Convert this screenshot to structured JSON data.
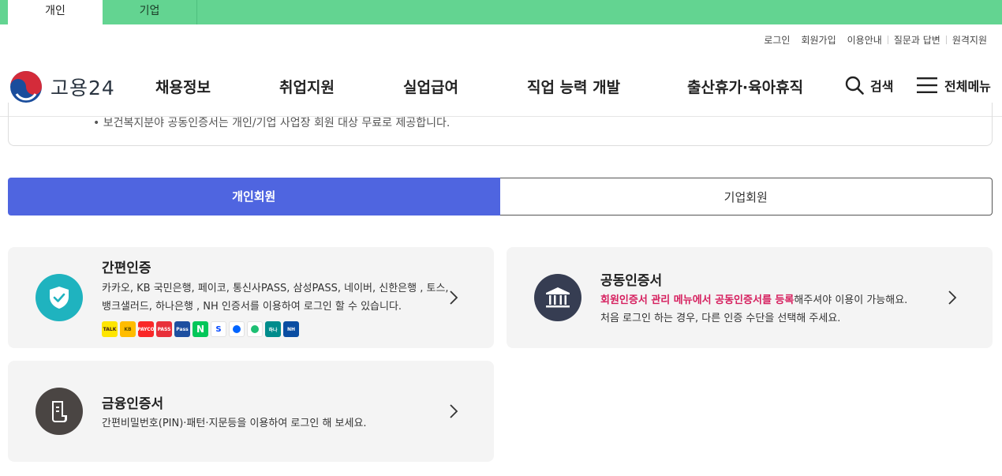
{
  "top_tabs": [
    {
      "label": "개인",
      "active": true
    },
    {
      "label": "기업",
      "active": false
    }
  ],
  "utility_links": [
    "로그인",
    "회원가입",
    "이용안내",
    "질문과 답변",
    "원격지원"
  ],
  "logo": {
    "text": "고용24"
  },
  "nav": [
    "채용정보",
    "취업지원",
    "실업급여",
    "직업 능력 개발",
    "출산휴가·육아휴직"
  ],
  "search": {
    "label": "검색"
  },
  "menu": {
    "label": "전체메뉴"
  },
  "notice": {
    "text": "• 보건복지분야 공동인증서는 개인/기업 사업장 회원 대상 무료로 제공합니다."
  },
  "member_tabs": [
    {
      "label": "개인회원",
      "active": true
    },
    {
      "label": "기업회원",
      "active": false
    }
  ],
  "cards": {
    "simple": {
      "title": "간편인증",
      "desc_line1": "카카오, KB 국민은행, 페이코, 통신사PASS, 삼성PASS, 네이버, 신한은행 , 토스,",
      "desc_line2": "뱅크샐러드, 하나은행 , NH 인증서를 이용하여 로그인 할 수 있습니다."
    },
    "joint": {
      "title": "공동인증서",
      "highlight": "회원인증서 관리 메뉴에서 공동인증서를 등록",
      "desc_line1_rest": "해주셔야 이용이 가능해요.",
      "desc_line2": "처음 로그인 하는 경우, 다른 인증 수단을 선택해 주세요."
    },
    "finance": {
      "title": "금융인증서",
      "desc": "간편비밀번호(PIN)·패턴·지문등을 이용하여 로그인 해 보세요."
    }
  },
  "providers": [
    {
      "name": "kakao",
      "label": "TALK",
      "color": "#fee500",
      "fg": "#3a1d1d"
    },
    {
      "name": "kb",
      "label": "KB",
      "color": "#ffbc00",
      "fg": "#5a4a00"
    },
    {
      "name": "payco",
      "label": "PAYCO",
      "color": "#fa2828",
      "fg": "#ffffff"
    },
    {
      "name": "pass",
      "label": "PASS",
      "color": "#e8303a",
      "fg": "#ffffff"
    },
    {
      "name": "samsung-pass",
      "label": "Pass",
      "color": "#1d4fa0",
      "fg": "#ffffff"
    },
    {
      "name": "naver",
      "label": "N",
      "color": "#03c75a",
      "fg": "#ffffff"
    },
    {
      "name": "shinhan",
      "label": "S",
      "color": "#ffffff",
      "fg": "#0046ff"
    },
    {
      "name": "toss",
      "label": "",
      "color": "#ffffff",
      "fg": "#0064ff"
    },
    {
      "name": "banksalad",
      "label": "",
      "color": "#ffffff",
      "fg": "#1dbf73"
    },
    {
      "name": "hana",
      "label": "하나",
      "color": "#008c8c",
      "fg": "#ffffff"
    },
    {
      "name": "nh",
      "label": "NH",
      "color": "#0a4da2",
      "fg": "#ffffff"
    }
  ]
}
